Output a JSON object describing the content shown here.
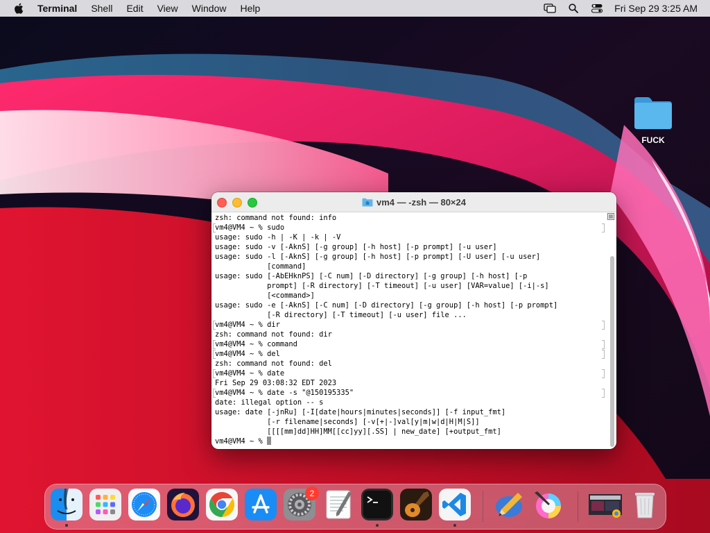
{
  "menubar": {
    "app_name": "Terminal",
    "items": [
      "Shell",
      "Edit",
      "View",
      "Window",
      "Help"
    ],
    "clock": "Fri Sep 29  3:25 AM"
  },
  "desktop": {
    "folder_label": "FUCK"
  },
  "terminal": {
    "title": "vm4 — -zsh — 80×24",
    "lines": [
      {
        "text": "zsh: command not found: info",
        "prompt": false
      },
      {
        "text": "vm4@VM4 ~ % sudo",
        "prompt": true
      },
      {
        "text": "usage: sudo -h | -K | -k | -V",
        "prompt": false
      },
      {
        "text": "usage: sudo -v [-AknS] [-g group] [-h host] [-p prompt] [-u user]",
        "prompt": false
      },
      {
        "text": "usage: sudo -l [-AknS] [-g group] [-h host] [-p prompt] [-U user] [-u user]",
        "prompt": false
      },
      {
        "text": "            [command]",
        "prompt": false
      },
      {
        "text": "usage: sudo [-AbEHknPS] [-C num] [-D directory] [-g group] [-h host] [-p",
        "prompt": false
      },
      {
        "text": "            prompt] [-R directory] [-T timeout] [-u user] [VAR=value] [-i|-s]",
        "prompt": false
      },
      {
        "text": "            [<command>]",
        "prompt": false
      },
      {
        "text": "usage: sudo -e [-AknS] [-C num] [-D directory] [-g group] [-h host] [-p prompt]",
        "prompt": false
      },
      {
        "text": "            [-R directory] [-T timeout] [-u user] file ...",
        "prompt": false
      },
      {
        "text": "vm4@VM4 ~ % dir",
        "prompt": true
      },
      {
        "text": "zsh: command not found: dir",
        "prompt": false
      },
      {
        "text": "vm4@VM4 ~ % command",
        "prompt": true
      },
      {
        "text": "vm4@VM4 ~ % del",
        "prompt": true
      },
      {
        "text": "zsh: command not found: del",
        "prompt": false
      },
      {
        "text": "vm4@VM4 ~ % date",
        "prompt": true
      },
      {
        "text": "Fri Sep 29 03:08:32 EDT 2023",
        "prompt": false
      },
      {
        "text": "vm4@VM4 ~ % date -s \"@150195335\"",
        "prompt": true
      },
      {
        "text": "date: illegal option -- s",
        "prompt": false
      },
      {
        "text": "usage: date [-jnRu] [-I[date|hours|minutes|seconds]] [-f input_fmt]",
        "prompt": false
      },
      {
        "text": "            [-r filename|seconds] [-v[+|-]val[y|m|w|d|H|M|S]]",
        "prompt": false
      },
      {
        "text": "            [[[[mm]dd]HH]MM[[cc]yy][.SS] | new_date] [+output_fmt]",
        "prompt": false
      }
    ],
    "current_prompt": "vm4@VM4 ~ % "
  },
  "dock": {
    "apps": [
      {
        "name": "finder",
        "running": true
      },
      {
        "name": "launchpad",
        "running": false
      },
      {
        "name": "safari",
        "running": false
      },
      {
        "name": "firefox",
        "running": false
      },
      {
        "name": "chrome",
        "running": false
      },
      {
        "name": "app-store",
        "running": false
      },
      {
        "name": "system-settings",
        "running": false,
        "badge": "2"
      },
      {
        "name": "textedit",
        "running": false
      },
      {
        "name": "terminal",
        "running": true
      },
      {
        "name": "garageband",
        "running": false
      },
      {
        "name": "vscode",
        "running": true
      },
      {
        "name": "pencil-app",
        "running": false
      },
      {
        "name": "color-picker",
        "running": false
      },
      {
        "name": "recent-document",
        "running": false
      },
      {
        "name": "trash",
        "running": false
      }
    ]
  }
}
